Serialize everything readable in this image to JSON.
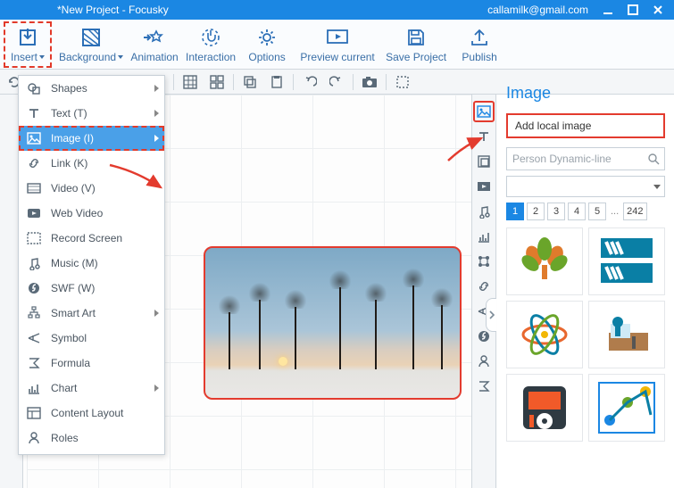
{
  "titlebar": {
    "title": "*New Project - Focusky",
    "email": "callamilk@gmail.com"
  },
  "ribbon": {
    "insert": "Insert",
    "background": "Background",
    "animation": "Animation",
    "interaction": "Interaction",
    "options": "Options",
    "preview": "Preview current",
    "save": "Save Project",
    "publish": "Publish"
  },
  "insert_menu": {
    "shapes": "Shapes",
    "text": "Text (T)",
    "image": "Image (I)",
    "link": "Link (K)",
    "video": "Video (V)",
    "webvideo": "Web Video",
    "recordscreen": "Record Screen",
    "music": "Music (M)",
    "swf": "SWF (W)",
    "smartart": "Smart Art",
    "symbol": "Symbol",
    "formula": "Formula",
    "chart": "Chart",
    "contentlayout": "Content Layout",
    "roles": "Roles"
  },
  "right_panel": {
    "title": "Image",
    "add_local": "Add local image",
    "search_placeholder": "Person Dynamic-line",
    "pages": [
      "1",
      "2",
      "3",
      "4",
      "5"
    ],
    "pages_ellipsis": "...",
    "pages_last": "242"
  }
}
